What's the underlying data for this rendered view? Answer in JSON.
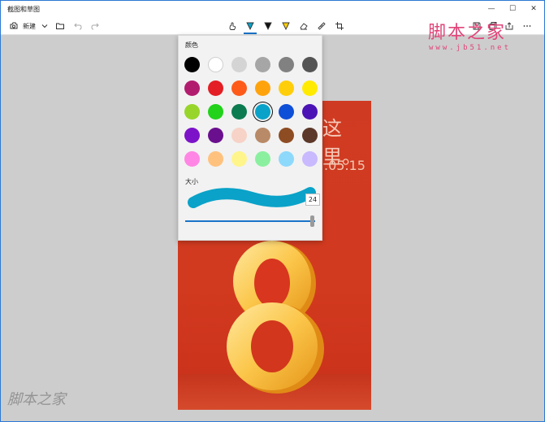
{
  "window": {
    "title": "截图和草图",
    "controls": [
      "—",
      "☐",
      "✕"
    ]
  },
  "toolbar": {
    "new_label": "新建",
    "icons": [
      "new-icon",
      "dropdown-icon",
      "folder-icon",
      "undo-icon",
      "redo-icon",
      "touch-writing-icon",
      "ballpoint-pen-icon",
      "pencil-icon",
      "highlighter-icon",
      "eraser-icon",
      "ruler-icon",
      "crop-icon",
      "save-icon",
      "copy-icon",
      "share-icon",
      "more-icon"
    ],
    "colors": {
      "active": "#1a73c8"
    }
  },
  "panel": {
    "color_label": "颜色",
    "size_label": "大小",
    "size_value": "24",
    "size_fraction": 0.98,
    "selected_color": "#0aa2c8",
    "swatches": [
      [
        "#000000",
        "#ffffff",
        "#d4d4d4",
        "#a6a6a6",
        "#818181",
        "#545454"
      ],
      [
        "#b21c6f",
        "#e31e24",
        "#fe5a1a",
        "#ffa30d",
        "#ffce0a",
        "#ffea00"
      ],
      [
        "#98d52a",
        "#22d21b",
        "#0c7b4f",
        "#0aa2c8",
        "#0e4fd8",
        "#4b13b5"
      ],
      [
        "#7c13c9",
        "#6a0f8e",
        "#f7d2c6",
        "#b98a67",
        "#8e4c23",
        "#5c382a"
      ],
      [
        "#ff86e4",
        "#ffc27e",
        "#fff58a",
        "#8af0a0",
        "#8cd9fc",
        "#c9b9ff"
      ]
    ]
  },
  "poster": {
    "text_line1": "这里。",
    "text_line2": ".05.15",
    "digit": "8"
  },
  "watermarks": {
    "top_right": "脚本之家",
    "top_right_url": "www.jb51.net",
    "bottom_left": "脚本之家"
  }
}
